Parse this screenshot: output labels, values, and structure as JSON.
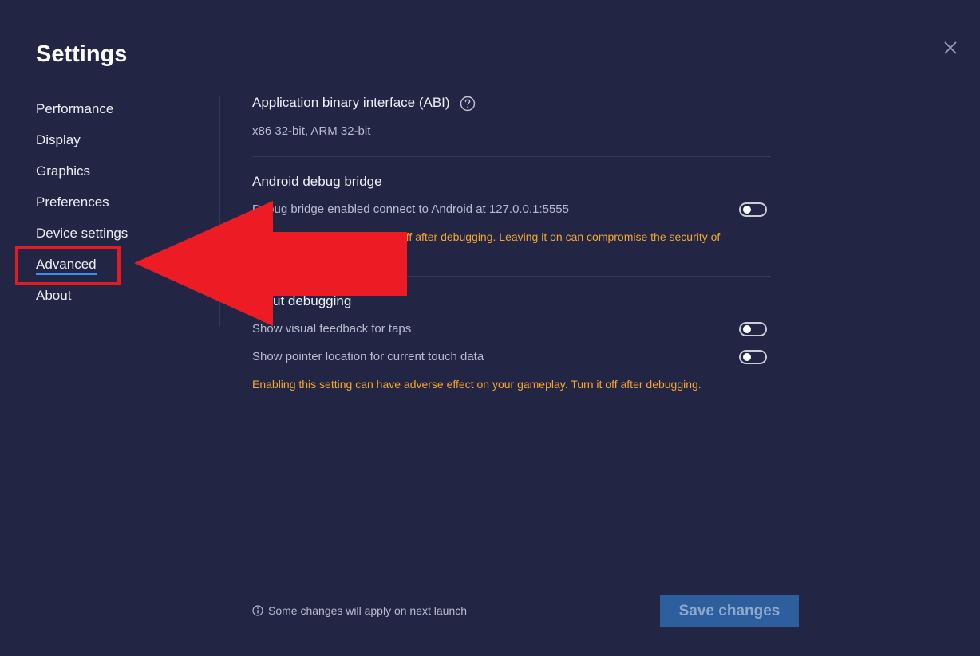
{
  "window": {
    "title": "Settings",
    "close_icon": "close-icon"
  },
  "sidebar": {
    "items": [
      {
        "label": "Performance",
        "active": false
      },
      {
        "label": "Display",
        "active": false
      },
      {
        "label": "Graphics",
        "active": false
      },
      {
        "label": "Preferences",
        "active": false
      },
      {
        "label": "Device settings",
        "active": false
      },
      {
        "label": "Advanced",
        "active": true
      },
      {
        "label": "About",
        "active": false
      }
    ]
  },
  "abi": {
    "title": "Application binary interface (ABI)",
    "help_icon": "help-circle-icon",
    "value": "x86 32-bit, ARM 32-bit"
  },
  "adb": {
    "title": "Android debug bridge",
    "toggle_label": "Debug bridge enabled connect to Android at 127.0.0.1:5555",
    "toggle_on": false,
    "warning": "off after debugging. Leaving it on can compromise the security of"
  },
  "input_debugging": {
    "title": "ut debugging",
    "options": [
      {
        "label": "Show visual feedback for taps",
        "on": false
      },
      {
        "label": "Show pointer location for current touch data",
        "on": false
      }
    ],
    "warning": "Enabling this setting can have adverse effect on your gameplay. Turn it off after  debugging."
  },
  "footer": {
    "note": "Some changes will apply on next launch",
    "info_icon": "info-icon",
    "save_label": "Save changes"
  },
  "colors": {
    "background": "#222544",
    "accent": "#3d8ef0",
    "warning": "#f4a72e",
    "save_button": "#2d5f9e",
    "annotation": "#e51b24"
  }
}
